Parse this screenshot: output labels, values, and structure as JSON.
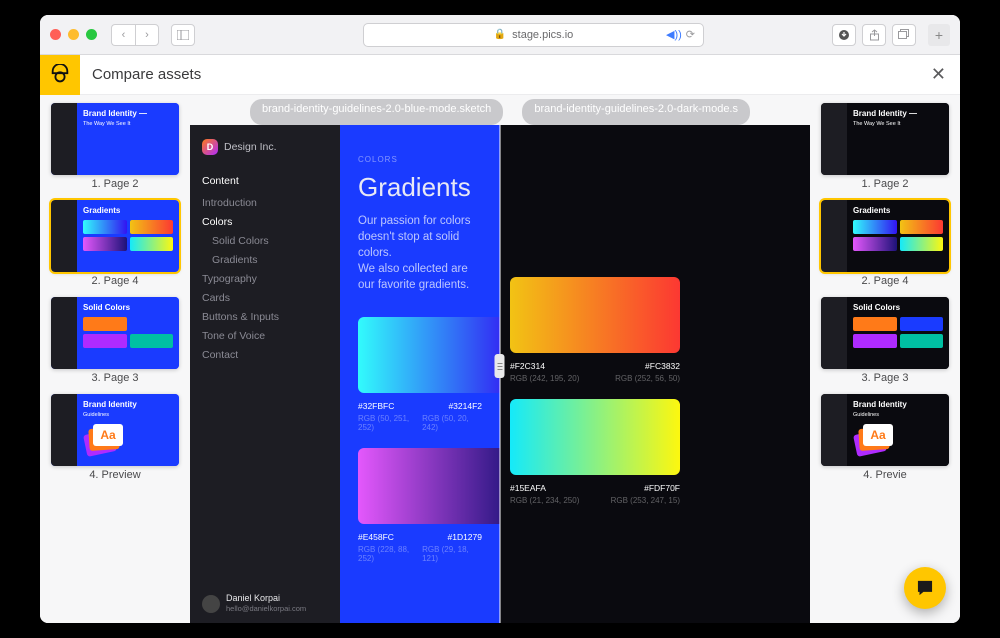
{
  "browser": {
    "url": "stage.pics.io"
  },
  "appbar": {
    "title": "Compare assets"
  },
  "files": {
    "left": "brand-identity-guidelines-2.0-blue-mode.sketch",
    "right": "brand-identity-guidelines-2.0-dark-mode.s"
  },
  "doc": {
    "brand": "Design Inc.",
    "nav_title": "Content",
    "nav": [
      "Introduction",
      "Colors",
      "Solid Colors",
      "Gradients",
      "Typography",
      "Cards",
      "Buttons & Inputs",
      "Tone of Voice",
      "Contact"
    ],
    "eyebrow": "COLORS",
    "heading": "Gradients",
    "body1": "Our passion for colors doesn't stop at solid colors.",
    "body2": "We also collected are our favorite gradients.",
    "author": {
      "name": "Daniel Korpai",
      "email": "hello@danielkorpai.com"
    },
    "swatches_blue": [
      {
        "hex_a": "#32FBFC",
        "hex_b": "#3214F2",
        "rgb_a": "RGB (50, 251, 252)",
        "rgb_b": "RGB (50, 20, 242)"
      },
      {
        "hex_a": "#E458FC",
        "hex_b": "#1D1279",
        "rgb_a": "RGB (228, 88, 252)",
        "rgb_b": "RGB (29, 18, 121)"
      }
    ],
    "swatches_dark": [
      {
        "hex_a": "#F2C314",
        "hex_b": "#FC3832",
        "rgb_a": "RGB (242, 195, 20)",
        "rgb_b": "RGB (252, 56, 50)"
      },
      {
        "hex_a": "#15EAFA",
        "hex_b": "#FDF70F",
        "rgb_a": "RGB (21, 234, 250)",
        "rgb_b": "RGB (253, 247, 15)"
      }
    ]
  },
  "thumbs_left": [
    {
      "label": "1. Page 2"
    },
    {
      "label": "2. Page 4"
    },
    {
      "label": "3. Page 3"
    },
    {
      "label": "4. Preview"
    }
  ],
  "thumbs_right": [
    {
      "label": "1. Page 2"
    },
    {
      "label": "2. Page 4"
    },
    {
      "label": "3. Page 3"
    },
    {
      "label": "4. Previe"
    }
  ],
  "mini_text": {
    "brand_identity_title": "Brand Identity —",
    "brand_identity_sub": "The Way We See It",
    "gradients": "Gradients",
    "solid_colors": "Solid Colors",
    "guidelines_title": "Brand Identity",
    "guidelines_sub": "Guidelines"
  }
}
